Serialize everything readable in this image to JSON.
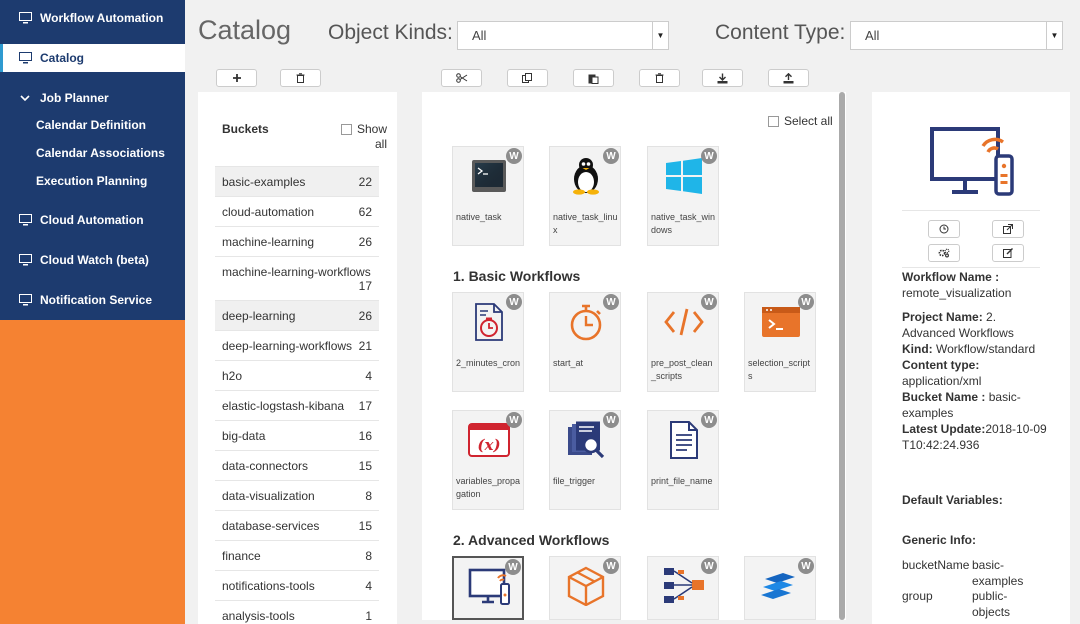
{
  "nav": {
    "workflow_automation": "Workflow Automation",
    "catalog": "Catalog",
    "job_planner": "Job Planner",
    "calendar_definition": "Calendar Definition",
    "calendar_associations": "Calendar Associations",
    "execution_planning": "Execution Planning",
    "cloud_automation": "Cloud Automation",
    "cloud_watch": "Cloud Watch (beta)",
    "notification_service": "Notification Service"
  },
  "header": {
    "title": "Catalog",
    "object_kinds_label": "Object Kinds:",
    "object_kinds_value": "All",
    "content_type_label": "Content Type:",
    "content_type_value": "All"
  },
  "buckets": {
    "title": "Buckets",
    "show_all": "Show all",
    "rows": [
      {
        "name": "basic-examples",
        "count": "22"
      },
      {
        "name": "cloud-automation",
        "count": "62"
      },
      {
        "name": "machine-learning",
        "count": "26"
      },
      {
        "name": "machine-learning-workflows",
        "count": "17"
      },
      {
        "name": "deep-learning",
        "count": "26"
      },
      {
        "name": "deep-learning-workflows",
        "count": "21"
      },
      {
        "name": "h2o",
        "count": "4"
      },
      {
        "name": "elastic-logstash-kibana",
        "count": "17"
      },
      {
        "name": "big-data",
        "count": "16"
      },
      {
        "name": "data-connectors",
        "count": "15"
      },
      {
        "name": "data-visualization",
        "count": "8"
      },
      {
        "name": "database-services",
        "count": "15"
      },
      {
        "name": "finance",
        "count": "8"
      },
      {
        "name": "notifications-tools",
        "count": "4"
      },
      {
        "name": "analysis-tools",
        "count": "1"
      }
    ]
  },
  "workflows": {
    "select_all": "Select all",
    "badge": "W",
    "section_basic": "1. Basic Workflows",
    "section_advanced": "2. Advanced Workflows",
    "top": [
      "native_task",
      "native_task_linux",
      "native_task_windows"
    ],
    "basic": [
      "2_minutes_cron",
      "start_at",
      "pre_post_clean_scripts",
      "selection_scripts",
      "variables_propagation",
      "file_trigger",
      "print_file_name"
    ]
  },
  "details": {
    "workflow_name_label": "Workflow Name :",
    "workflow_name_value": "remote_visualization",
    "project_name_label": "Project Name:",
    "project_name_value": "2. Advanced Workflows",
    "kind_label": "Kind:",
    "kind_value": "Workflow/standard",
    "content_type_label": "Content type:",
    "content_type_value": "application/xml",
    "bucket_name_label": "Bucket Name :",
    "bucket_name_value": "basic-examples",
    "latest_update_label": "Latest Update:",
    "latest_update_value": "2018-10-09T10:42:24.936",
    "default_variables_label": "Default Variables:",
    "generic_info_label": "Generic Info:",
    "generic_info": [
      {
        "key": "bucketName",
        "value": "basic-examples"
      },
      {
        "key": "group",
        "value": "public-objects"
      }
    ]
  },
  "colors": {
    "nav_bg": "#1d3b6f",
    "accent": "#f58232",
    "icon_orange": "#e8742a",
    "icon_navy": "#2b3a78"
  }
}
